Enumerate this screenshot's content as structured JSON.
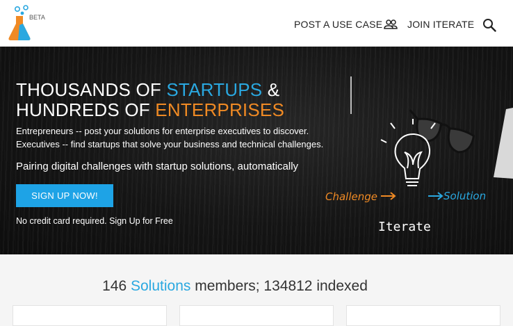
{
  "header": {
    "beta_label": "BETA",
    "nav": {
      "post_use_case": "POST A USE CASE",
      "join_iterate": "JOIN ITERATE"
    }
  },
  "hero": {
    "title_line1_prefix": "THOUSANDS OF ",
    "title_line1_highlight": "STARTUPS",
    "title_line1_suffix": " &",
    "title_line2_prefix": "HUNDREDS OF ",
    "title_line2_highlight": "ENTERPRISES",
    "desc_line1": "Entrepreneurs -- post your solutions for enterprise executives to discover.",
    "desc_line2": "Executives -- find startups that solve your business and technical challenges.",
    "tagline": "Pairing digital challenges with startup solutions, automatically",
    "signup_button": "SIGN UP NOW!",
    "no_credit": "No credit card required. Sign Up for Free",
    "sketch": {
      "challenge": "Challenge",
      "solution": "Solution",
      "iterate": "Iterate"
    }
  },
  "stats": {
    "count": "146",
    "highlight": "Solutions",
    "rest": " members; 134812 indexed"
  },
  "colors": {
    "accent_blue": "#2aa8e0",
    "accent_orange": "#f08a24",
    "button_blue": "#1ea3e6"
  }
}
